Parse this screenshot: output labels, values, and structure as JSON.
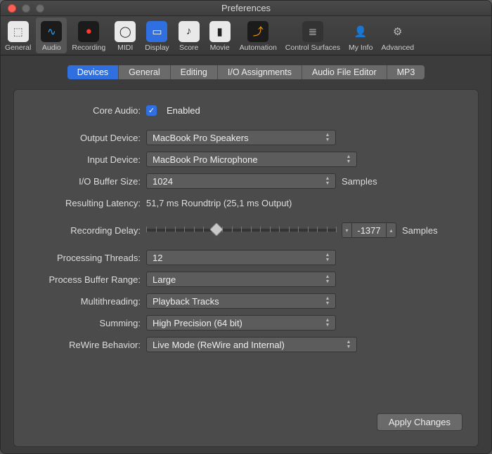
{
  "window": {
    "title": "Preferences"
  },
  "toolbar": [
    {
      "label": "General",
      "selected": false,
      "icon_bg": "#e9e9e9",
      "icon_fg": "#555",
      "glyph": "⬚"
    },
    {
      "label": "Audio",
      "selected": true,
      "icon_bg": "#1b1b1b",
      "icon_fg": "#2fa6ff",
      "glyph": "∿"
    },
    {
      "label": "Recording",
      "selected": false,
      "icon_bg": "#1b1b1b",
      "icon_fg": "#ff3b30",
      "glyph": "●"
    },
    {
      "label": "MIDI",
      "selected": false,
      "icon_bg": "#e9e9e9",
      "icon_fg": "#222",
      "glyph": "◯"
    },
    {
      "label": "Display",
      "selected": false,
      "icon_bg": "#2f6fe0",
      "icon_fg": "#fff",
      "glyph": "▭"
    },
    {
      "label": "Score",
      "selected": false,
      "icon_bg": "#e9e9e9",
      "icon_fg": "#222",
      "glyph": "♪"
    },
    {
      "label": "Movie",
      "selected": false,
      "icon_bg": "#e9e9e9",
      "icon_fg": "#222",
      "glyph": "▮"
    },
    {
      "label": "Automation",
      "selected": false,
      "icon_bg": "#1b1b1b",
      "icon_fg": "#ff9f0a",
      "glyph": "⤴"
    },
    {
      "label": "Control Surfaces",
      "selected": false,
      "icon_bg": "#333",
      "icon_fg": "#bbb",
      "glyph": "≣"
    },
    {
      "label": "My Info",
      "selected": false,
      "icon_bg": "transparent",
      "icon_fg": "#bbb",
      "glyph": "👤"
    },
    {
      "label": "Advanced",
      "selected": false,
      "icon_bg": "transparent",
      "icon_fg": "#bbb",
      "glyph": "⚙"
    }
  ],
  "tabs": [
    {
      "label": "Devices",
      "selected": true
    },
    {
      "label": "General",
      "selected": false
    },
    {
      "label": "Editing",
      "selected": false
    },
    {
      "label": "I/O Assignments",
      "selected": false
    },
    {
      "label": "Audio File Editor",
      "selected": false
    },
    {
      "label": "MP3",
      "selected": false
    }
  ],
  "labels": {
    "core_audio": "Core Audio:",
    "output_device": "Output Device:",
    "input_device": "Input Device:",
    "io_buffer": "I/O Buffer Size:",
    "resulting_latency": "Resulting Latency:",
    "recording_delay": "Recording Delay:",
    "processing_threads": "Processing Threads:",
    "process_buffer_range": "Process Buffer Range:",
    "multithreading": "Multithreading:",
    "summing": "Summing:",
    "rewire": "ReWire Behavior:"
  },
  "values": {
    "core_audio_checked": true,
    "core_audio_label": "Enabled",
    "output_device": "MacBook Pro Speakers",
    "input_device": "MacBook Pro Microphone",
    "io_buffer": "1024",
    "io_buffer_suffix": "Samples",
    "resulting_latency": "51,7 ms Roundtrip (25,1 ms Output)",
    "recording_delay": "-1377",
    "recording_delay_suffix": "Samples",
    "recording_delay_slider_pos": 0.37,
    "processing_threads": "12",
    "process_buffer_range": "Large",
    "multithreading": "Playback Tracks",
    "summing": "High Precision (64 bit)",
    "rewire": "Live Mode (ReWire and Internal)"
  },
  "apply_label": "Apply Changes"
}
